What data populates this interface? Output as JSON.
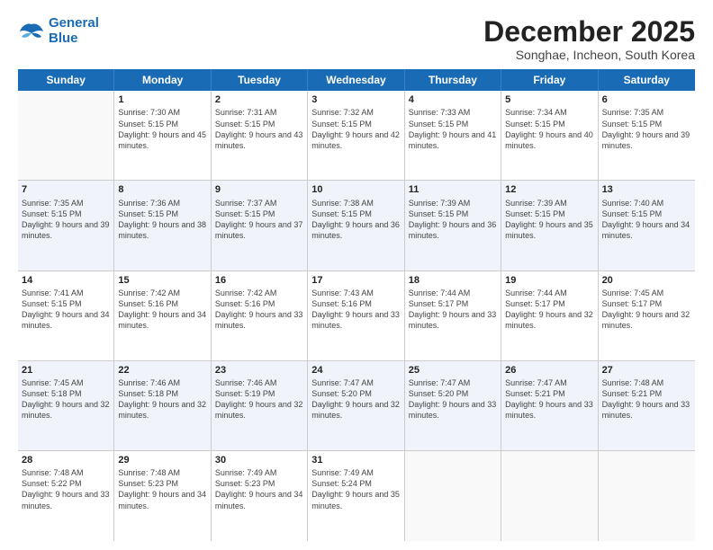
{
  "logo": {
    "line1": "General",
    "line2": "Blue"
  },
  "title": "December 2025",
  "subtitle": "Songhae, Incheon, South Korea",
  "days": [
    "Sunday",
    "Monday",
    "Tuesday",
    "Wednesday",
    "Thursday",
    "Friday",
    "Saturday"
  ],
  "weeks": [
    [
      {
        "num": "",
        "sunrise": "",
        "sunset": "",
        "daylight": ""
      },
      {
        "num": "1",
        "sunrise": "Sunrise: 7:30 AM",
        "sunset": "Sunset: 5:15 PM",
        "daylight": "Daylight: 9 hours and 45 minutes."
      },
      {
        "num": "2",
        "sunrise": "Sunrise: 7:31 AM",
        "sunset": "Sunset: 5:15 PM",
        "daylight": "Daylight: 9 hours and 43 minutes."
      },
      {
        "num": "3",
        "sunrise": "Sunrise: 7:32 AM",
        "sunset": "Sunset: 5:15 PM",
        "daylight": "Daylight: 9 hours and 42 minutes."
      },
      {
        "num": "4",
        "sunrise": "Sunrise: 7:33 AM",
        "sunset": "Sunset: 5:15 PM",
        "daylight": "Daylight: 9 hours and 41 minutes."
      },
      {
        "num": "5",
        "sunrise": "Sunrise: 7:34 AM",
        "sunset": "Sunset: 5:15 PM",
        "daylight": "Daylight: 9 hours and 40 minutes."
      },
      {
        "num": "6",
        "sunrise": "Sunrise: 7:35 AM",
        "sunset": "Sunset: 5:15 PM",
        "daylight": "Daylight: 9 hours and 39 minutes."
      }
    ],
    [
      {
        "num": "7",
        "sunrise": "Sunrise: 7:35 AM",
        "sunset": "Sunset: 5:15 PM",
        "daylight": "Daylight: 9 hours and 39 minutes."
      },
      {
        "num": "8",
        "sunrise": "Sunrise: 7:36 AM",
        "sunset": "Sunset: 5:15 PM",
        "daylight": "Daylight: 9 hours and 38 minutes."
      },
      {
        "num": "9",
        "sunrise": "Sunrise: 7:37 AM",
        "sunset": "Sunset: 5:15 PM",
        "daylight": "Daylight: 9 hours and 37 minutes."
      },
      {
        "num": "10",
        "sunrise": "Sunrise: 7:38 AM",
        "sunset": "Sunset: 5:15 PM",
        "daylight": "Daylight: 9 hours and 36 minutes."
      },
      {
        "num": "11",
        "sunrise": "Sunrise: 7:39 AM",
        "sunset": "Sunset: 5:15 PM",
        "daylight": "Daylight: 9 hours and 36 minutes."
      },
      {
        "num": "12",
        "sunrise": "Sunrise: 7:39 AM",
        "sunset": "Sunset: 5:15 PM",
        "daylight": "Daylight: 9 hours and 35 minutes."
      },
      {
        "num": "13",
        "sunrise": "Sunrise: 7:40 AM",
        "sunset": "Sunset: 5:15 PM",
        "daylight": "Daylight: 9 hours and 34 minutes."
      }
    ],
    [
      {
        "num": "14",
        "sunrise": "Sunrise: 7:41 AM",
        "sunset": "Sunset: 5:15 PM",
        "daylight": "Daylight: 9 hours and 34 minutes."
      },
      {
        "num": "15",
        "sunrise": "Sunrise: 7:42 AM",
        "sunset": "Sunset: 5:16 PM",
        "daylight": "Daylight: 9 hours and 34 minutes."
      },
      {
        "num": "16",
        "sunrise": "Sunrise: 7:42 AM",
        "sunset": "Sunset: 5:16 PM",
        "daylight": "Daylight: 9 hours and 33 minutes."
      },
      {
        "num": "17",
        "sunrise": "Sunrise: 7:43 AM",
        "sunset": "Sunset: 5:16 PM",
        "daylight": "Daylight: 9 hours and 33 minutes."
      },
      {
        "num": "18",
        "sunrise": "Sunrise: 7:44 AM",
        "sunset": "Sunset: 5:17 PM",
        "daylight": "Daylight: 9 hours and 33 minutes."
      },
      {
        "num": "19",
        "sunrise": "Sunrise: 7:44 AM",
        "sunset": "Sunset: 5:17 PM",
        "daylight": "Daylight: 9 hours and 32 minutes."
      },
      {
        "num": "20",
        "sunrise": "Sunrise: 7:45 AM",
        "sunset": "Sunset: 5:17 PM",
        "daylight": "Daylight: 9 hours and 32 minutes."
      }
    ],
    [
      {
        "num": "21",
        "sunrise": "Sunrise: 7:45 AM",
        "sunset": "Sunset: 5:18 PM",
        "daylight": "Daylight: 9 hours and 32 minutes."
      },
      {
        "num": "22",
        "sunrise": "Sunrise: 7:46 AM",
        "sunset": "Sunset: 5:18 PM",
        "daylight": "Daylight: 9 hours and 32 minutes."
      },
      {
        "num": "23",
        "sunrise": "Sunrise: 7:46 AM",
        "sunset": "Sunset: 5:19 PM",
        "daylight": "Daylight: 9 hours and 32 minutes."
      },
      {
        "num": "24",
        "sunrise": "Sunrise: 7:47 AM",
        "sunset": "Sunset: 5:20 PM",
        "daylight": "Daylight: 9 hours and 32 minutes."
      },
      {
        "num": "25",
        "sunrise": "Sunrise: 7:47 AM",
        "sunset": "Sunset: 5:20 PM",
        "daylight": "Daylight: 9 hours and 33 minutes."
      },
      {
        "num": "26",
        "sunrise": "Sunrise: 7:47 AM",
        "sunset": "Sunset: 5:21 PM",
        "daylight": "Daylight: 9 hours and 33 minutes."
      },
      {
        "num": "27",
        "sunrise": "Sunrise: 7:48 AM",
        "sunset": "Sunset: 5:21 PM",
        "daylight": "Daylight: 9 hours and 33 minutes."
      }
    ],
    [
      {
        "num": "28",
        "sunrise": "Sunrise: 7:48 AM",
        "sunset": "Sunset: 5:22 PM",
        "daylight": "Daylight: 9 hours and 33 minutes."
      },
      {
        "num": "29",
        "sunrise": "Sunrise: 7:48 AM",
        "sunset": "Sunset: 5:23 PM",
        "daylight": "Daylight: 9 hours and 34 minutes."
      },
      {
        "num": "30",
        "sunrise": "Sunrise: 7:49 AM",
        "sunset": "Sunset: 5:23 PM",
        "daylight": "Daylight: 9 hours and 34 minutes."
      },
      {
        "num": "31",
        "sunrise": "Sunrise: 7:49 AM",
        "sunset": "Sunset: 5:24 PM",
        "daylight": "Daylight: 9 hours and 35 minutes."
      },
      {
        "num": "",
        "sunrise": "",
        "sunset": "",
        "daylight": ""
      },
      {
        "num": "",
        "sunrise": "",
        "sunset": "",
        "daylight": ""
      },
      {
        "num": "",
        "sunrise": "",
        "sunset": "",
        "daylight": ""
      }
    ]
  ]
}
